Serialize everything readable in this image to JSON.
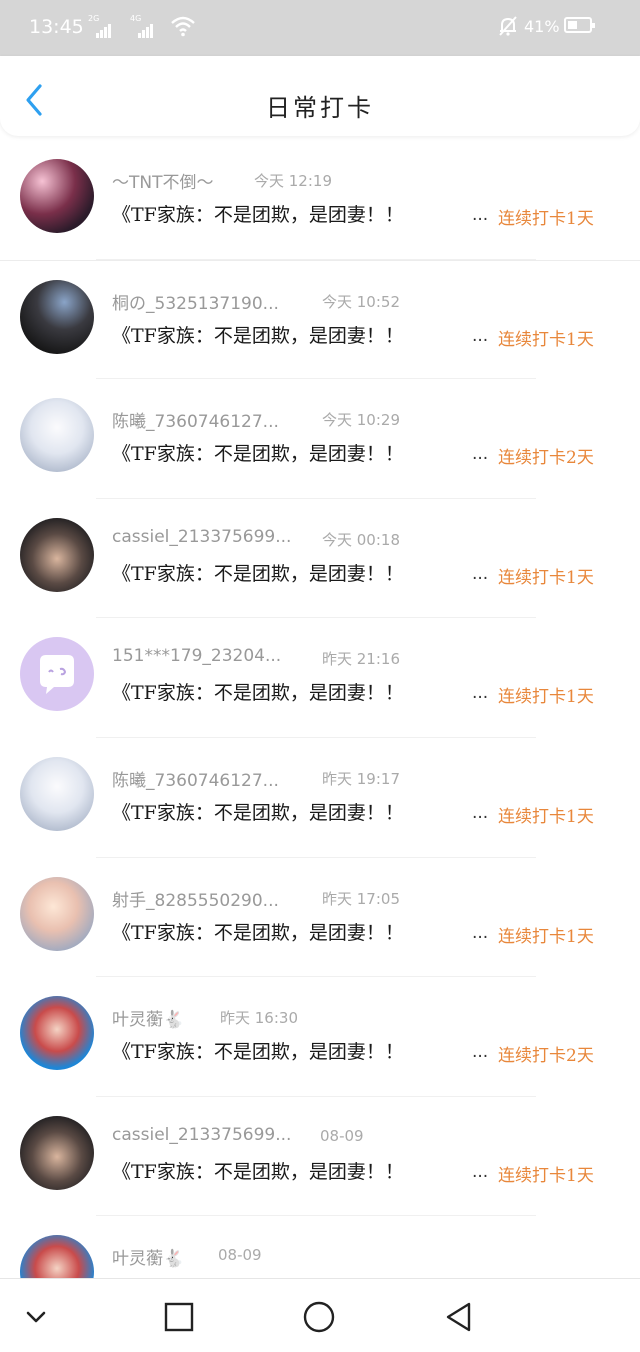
{
  "status_bar": {
    "time": "13:45",
    "sim1_tag": "2G",
    "sim2_tag": "4G",
    "battery": "41%",
    "icons": [
      "signal-icon",
      "wifi-icon",
      "mute-icon",
      "battery-icon"
    ]
  },
  "header": {
    "title": "日常打卡",
    "back_icon": "back-chevron-icon"
  },
  "colors": {
    "accent": "#2ea0f0",
    "streak": "#e8873b",
    "status_bar_bg": "#d6d6d6"
  },
  "checkins": [
    {
      "username": "～TNT不倒～",
      "time": "今天 12:19",
      "content": "《TF家族：不是团欺，是团妻！！",
      "ellipsis": "...",
      "streak": "连续打卡1天"
    },
    {
      "username": "桐の_5325137190...",
      "time": "今天 10:52",
      "content": "《TF家族：不是团欺，是团妻！！",
      "ellipsis": "...",
      "streak": "连续打卡1天"
    },
    {
      "username": "陈曦_7360746127...",
      "time": "今天 10:29",
      "content": "《TF家族：不是团欺，是团妻！！",
      "ellipsis": "...",
      "streak": "连续打卡2天"
    },
    {
      "username": "cassiel_213375699...",
      "time": "今天 00:18",
      "content": "《TF家族：不是团欺，是团妻！！",
      "ellipsis": "...",
      "streak": "连续打卡1天"
    },
    {
      "username": "151***179_23204...",
      "time": "昨天 21:16",
      "content": "《TF家族：不是团欺，是团妻！！",
      "ellipsis": "...",
      "streak": "连续打卡1天"
    },
    {
      "username": "陈曦_7360746127...",
      "time": "昨天 19:17",
      "content": "《TF家族：不是团欺，是团妻！！",
      "ellipsis": "...",
      "streak": "连续打卡1天"
    },
    {
      "username": "射手_8285550290...",
      "time": "昨天 17:05",
      "content": "《TF家族：不是团欺，是团妻！！",
      "ellipsis": "...",
      "streak": "连续打卡1天"
    },
    {
      "username": "叶灵蘅🐇",
      "time": "昨天 16:30",
      "content": "《TF家族：不是团欺，是团妻！！",
      "ellipsis": "...",
      "streak": "连续打卡2天"
    },
    {
      "username": "cassiel_213375699...",
      "time": "08-09",
      "content": "《TF家族：不是团欺，是团妻！！",
      "ellipsis": "...",
      "streak": "连续打卡1天"
    },
    {
      "username": "叶灵蘅🐇",
      "time": "08-09",
      "content": "",
      "ellipsis": "",
      "streak": ""
    }
  ],
  "bottom_nav": [
    "collapse-chevron-icon",
    "recents-square-icon",
    "home-circle-icon",
    "back-triangle-icon"
  ]
}
